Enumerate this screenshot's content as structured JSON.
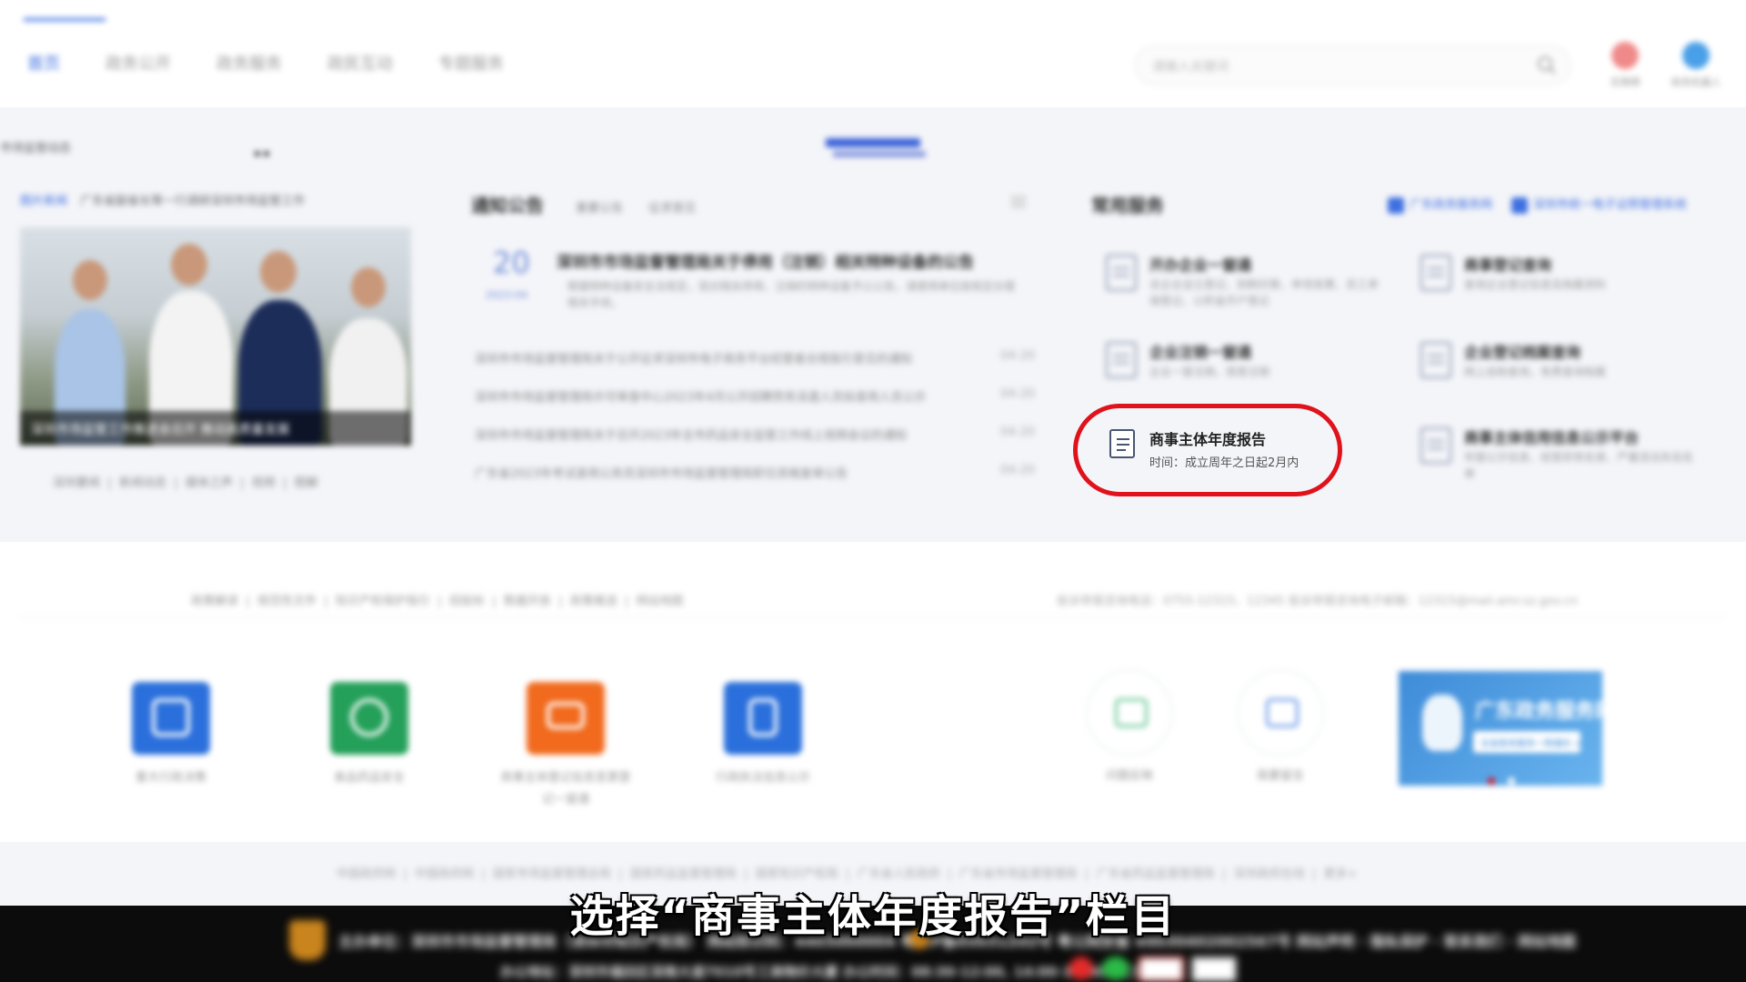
{
  "header": {
    "nav": [
      "首页",
      "政务公开",
      "政务服务",
      "政民互动",
      "专题服务"
    ],
    "search_placeholder": "请输入关键词",
    "icons": [
      {
        "label": "无障碍",
        "color": "#f08a8a"
      },
      {
        "label": "政务机器人",
        "color": "#4aa0e8"
      }
    ]
  },
  "ticker": "市场监管动态",
  "news": {
    "tag": "图片新闻",
    "headline": "广东省副省长等一行调研深圳市场监管工作",
    "caption": "深圳市场监管工作推进会召开 推动高质量发展",
    "links": [
      "深圳要闻",
      "新闻动态",
      "媒体之声",
      "视频",
      "图解"
    ]
  },
  "notice": {
    "title": "通知公告",
    "tabs": [
      "重要公告",
      "征求意见"
    ],
    "featured": {
      "day": "20",
      "ym": "2023-04",
      "title": "深圳市市场监督管理局关于停用（注销）相关特种设备的公告",
      "summary": "根据特种设备安全法规定，现对相关停用、注销的特种设备予以公告，请使用单位按规定办理相关手续。"
    },
    "items": [
      {
        "title": "深圳市市场监督管理局关于公开征求深圳市电子商务平台经营者合规指引意见的通知",
        "date": "04-20"
      },
      {
        "title": "深圳市市场监督管理局许可审查中心2023年4月公开招聘劳务派遣人员拟录用人员公示",
        "date": "04-20"
      },
      {
        "title": "深圳市市场监督管理局关于召开2023年全市药品安全监管工作线上视频会议的通知",
        "date": "04-20"
      },
      {
        "title": "广东省2023年考试录用公务员深圳市市场监督管理局职位资格复审公告",
        "date": "04-20"
      }
    ]
  },
  "services": {
    "title": "常用服务",
    "links": [
      "广东政务服务网",
      "深圳市统一电子证照管理系统"
    ],
    "items": [
      {
        "name": "开办企业一窗通",
        "desc": "含企业设立登记、刻制印章、申领发票、员工参保登记、公积金开户登记"
      },
      {
        "name": "商事登记查询",
        "desc": "查询企业登记信息及档案资料"
      },
      {
        "name": "企业注销一窗通",
        "desc": "企业一窗注销，简易注销"
      },
      {
        "name": "企业登记档案查询",
        "desc": "网上自助查询，免费查询档案"
      },
      {
        "name": "商事主体信用信息公示平台",
        "desc": "年报公示信息、经营异常名录、严重违法失信名单"
      }
    ],
    "highlight": {
      "name": "商事主体年度报告",
      "desc": "时间：成立周年之日起2月内"
    }
  },
  "footer_links": [
    "政策解读",
    "规范性文件",
    "知识产权保护指引",
    "招投标",
    "数据开放",
    "政策推送",
    "网站地图"
  ],
  "footer_contact": "投诉举报咨询电话：0755-12315、12345    投诉举报咨询电子邮箱：12315@mail.amr.sz.gov.cn",
  "apps": [
    {
      "label": "重大行政决策",
      "color": "#2a6fdb"
    },
    {
      "label": "食品药品安全",
      "color": "#24a05a"
    },
    {
      "label": "商事主体登记信息变更登记一窗通",
      "color": "#f16a1e"
    },
    {
      "label": "行政执法信息公示",
      "color": "#2a6fdb"
    }
  ],
  "round_apps": [
    {
      "label": "问题反映",
      "color": "#6ec99a"
    },
    {
      "label": "我要留言",
      "color": "#6e9be8"
    }
  ],
  "banner": {
    "title": "广东政务服务网",
    "button": "全省政务服务一网通办 >"
  },
  "bottom_links": [
    "中国政府网",
    "中国政府网",
    "国家市场监督管理总局",
    "国家药品监督管理局",
    "国家知识产权局",
    "广东省人民政府",
    "广东省市场监督管理局",
    "广东省药品监督管理局",
    "深圳政府在线",
    "更多+"
  ],
  "black_footer": {
    "line1": "主办单位：深圳市市场监督管理局（深圳市知识产权局）  网站标识码：4403000004  粤ICP备05031202号  粤公网安备 44030402002567号  网站声明 · 隐私保护 · 联系我们 · 网站地图",
    "line2": "办公地址：深圳市福田区深南大道7010号工商物价大厦  办公时间：08:30-12:00, 14:00-18:00（工作日）"
  },
  "subtitle": "选择“商事主体年度报告”栏目"
}
